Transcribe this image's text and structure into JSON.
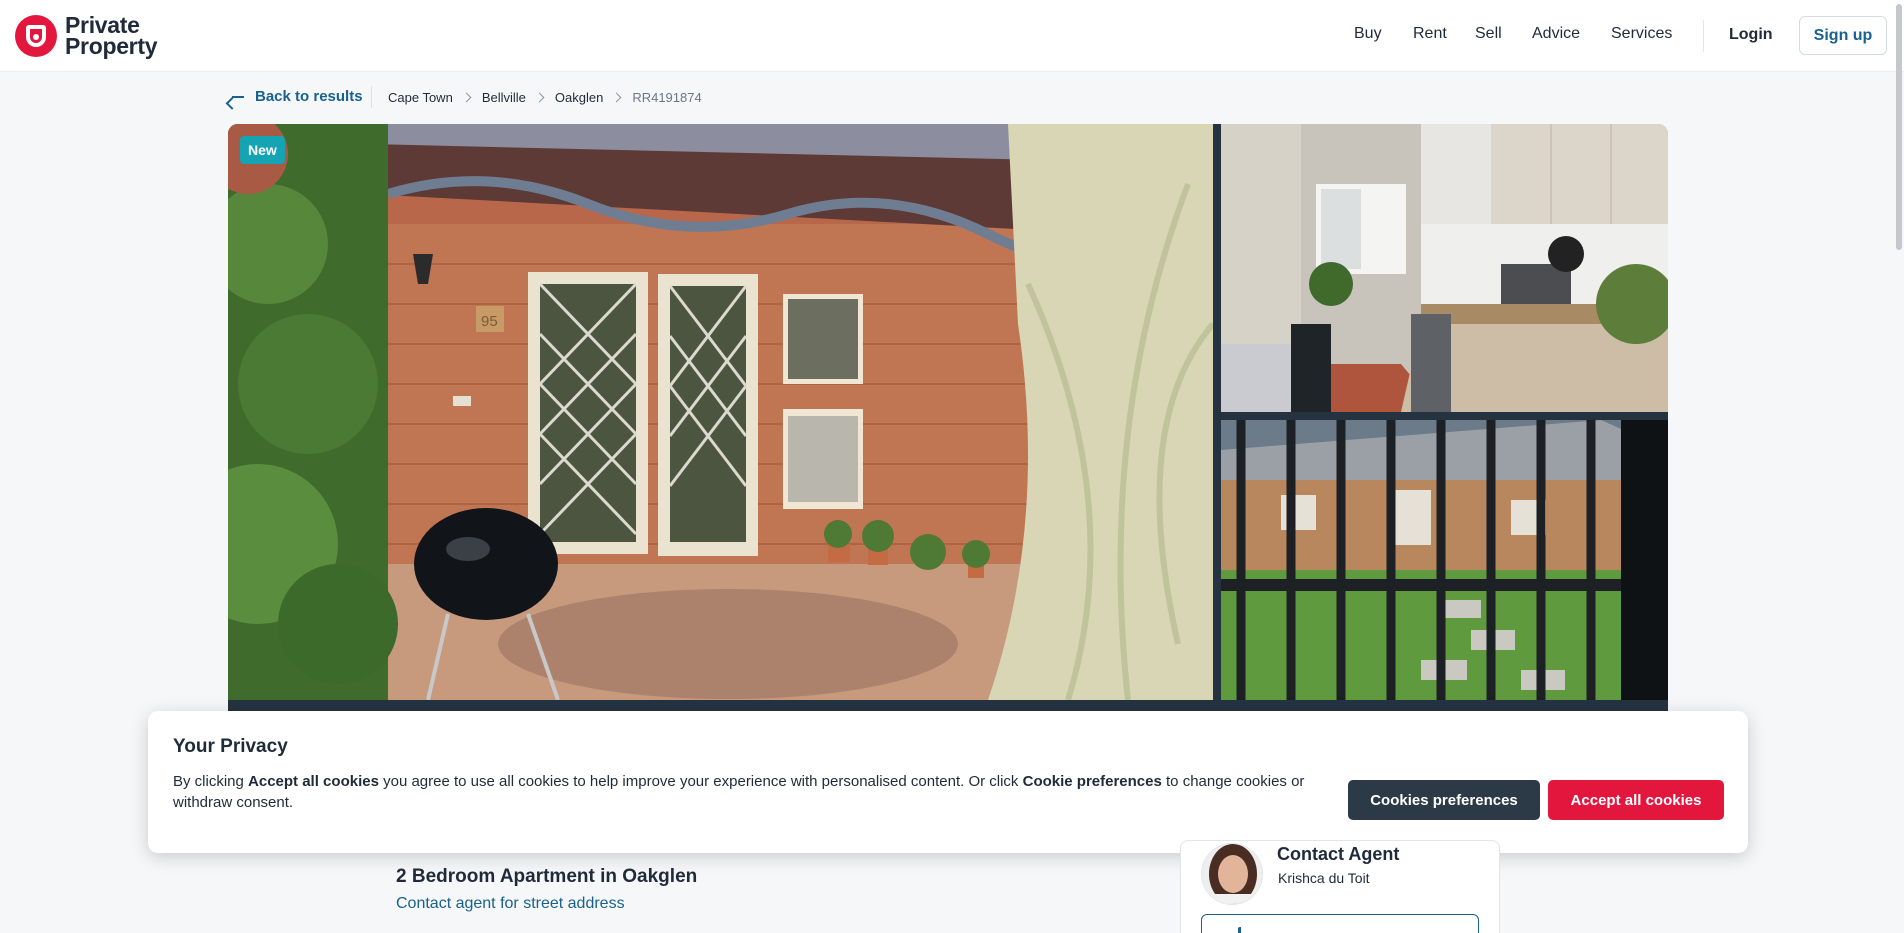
{
  "brand": {
    "name_line1": "Private",
    "name_line2": "Property",
    "accent": "#e3173e"
  },
  "nav": {
    "items": [
      "Buy",
      "Rent",
      "Sell",
      "Advice",
      "Services"
    ],
    "login": "Login",
    "signup": "Sign up"
  },
  "breadcrumb": {
    "back": "Back to results",
    "items": [
      "Cape Town",
      "Bellville",
      "Oakglen",
      "RR4191874"
    ]
  },
  "gallery": {
    "badge": "New",
    "house_number": "95"
  },
  "privacy": {
    "title": "Your Privacy",
    "text_1": "By clicking ",
    "bold_1": "Accept all cookies",
    "text_2": " you agree to use all cookies to help improve your experience with personalised content. Or click ",
    "bold_2": "Cookie preferences",
    "text_3": " to change cookies or withdraw consent.",
    "prefs_button": "Cookies preferences",
    "accept_button": "Accept all cookies"
  },
  "listing": {
    "title": "2 Bedroom Apartment in Oakglen",
    "address_link": "Contact agent for street address"
  },
  "agent": {
    "heading": "Contact Agent",
    "name": "Krishca du Toit"
  }
}
